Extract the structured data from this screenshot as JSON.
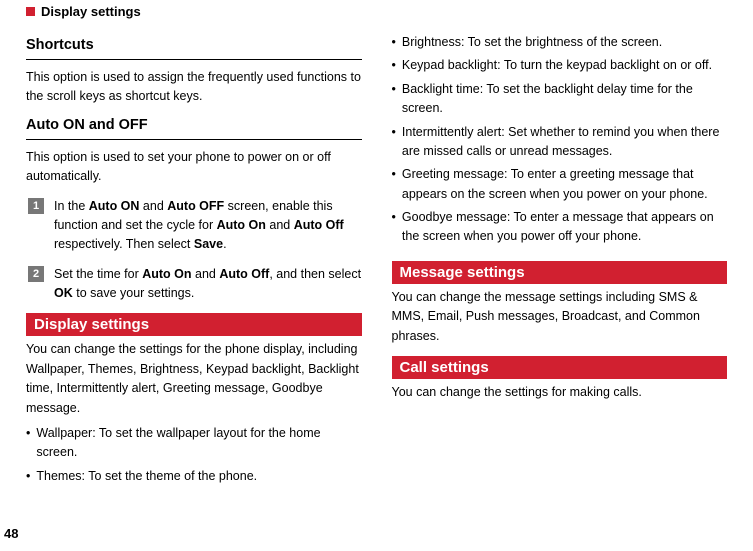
{
  "header": {
    "title": "Display settings"
  },
  "sections": {
    "shortcuts": {
      "heading": "Shortcuts",
      "text": "This option is used to assign the frequently used functions to the scroll keys as shortcut keys."
    },
    "autoOnOff": {
      "heading": "Auto ON and OFF",
      "text": "This option is used to set your phone to power on or off automatically.",
      "step1_a": "In the ",
      "step1_b": "Auto ON",
      "step1_c": " and ",
      "step1_d": "Auto OFF",
      "step1_e": " screen, enable this function and set the cycle for ",
      "step1_f": "Auto On",
      "step1_g": " and ",
      "step1_h": "Auto Off",
      "step1_i": " respectively. Then select ",
      "step1_j": "Save",
      "step1_k": ".",
      "step2_a": "Set the time for ",
      "step2_b": "Auto On",
      "step2_c": " and ",
      "step2_d": "Auto Off",
      "step2_e": ", and then select ",
      "step2_f": "OK",
      "step2_g": " to save your settings."
    },
    "display": {
      "banner": "Display settings",
      "intro": "You can change the settings for the phone display, including Wallpaper, Themes, Brightness, Keypad backlight, Backlight time, Intermittently alert, Greeting message, Goodbye message.",
      "bullets": {
        "b1": "Wallpaper: To set the wallpaper layout for the home screen.",
        "b2": "Themes: To set the theme of the phone.",
        "b3": "Brightness: To set the brightness of the screen.",
        "b4": "Keypad backlight: To turn the keypad backlight on or off.",
        "b5": "Backlight time: To set the backlight delay time for the screen.",
        "b6": "Intermittently alert: Set whether to remind you when there are missed calls or unread messages.",
        "b7": "Greeting message: To enter a greeting message that appears on the screen when you power on your phone.",
        "b8": "Goodbye message: To enter a message that appears on the screen when you power off your phone."
      }
    },
    "message": {
      "banner": "Message settings",
      "text": "You can change the message settings including SMS & MMS, Email, Push messages, Broadcast, and Common phrases."
    },
    "call": {
      "banner": "Call settings",
      "text": "You can change the settings for making calls."
    }
  },
  "pageNumber": "48"
}
